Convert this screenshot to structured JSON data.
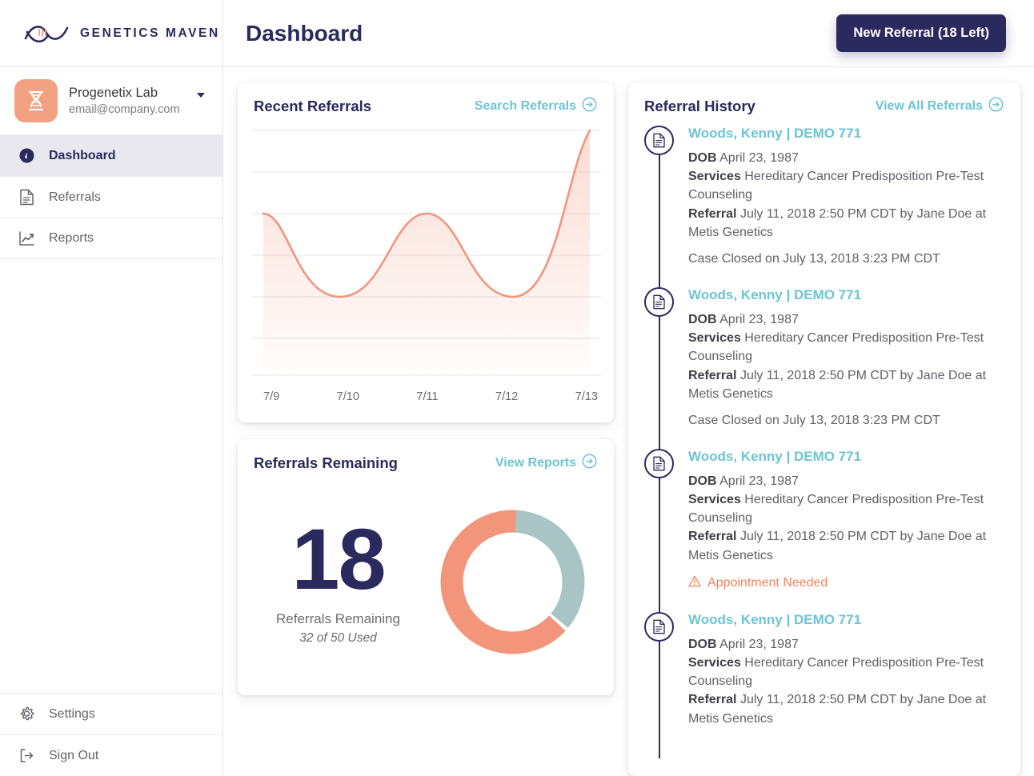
{
  "brand": {
    "name": "GENETICS MAVEN",
    "logo_icon": "dna-wave-icon"
  },
  "account": {
    "avatar_icon": "dna-helix-icon",
    "name": "Progenetix Lab",
    "email": "email@company.com",
    "caret_icon": "chevron-down-icon"
  },
  "sidebar": {
    "items": [
      {
        "label": "Dashboard",
        "icon": "gauge-icon",
        "active": true
      },
      {
        "label": "Referrals",
        "icon": "document-icon",
        "active": false
      },
      {
        "label": "Reports",
        "icon": "chart-line-icon",
        "active": false
      }
    ],
    "bottom_items": [
      {
        "label": "Settings",
        "icon": "gear-icon"
      },
      {
        "label": "Sign Out",
        "icon": "sign-out-icon"
      }
    ]
  },
  "header": {
    "title": "Dashboard",
    "new_referral_label": "New Referral (18 Left)"
  },
  "recent_referrals": {
    "title": "Recent Referrals",
    "link_label": "Search Referrals",
    "link_icon": "arrow-right-circle-icon"
  },
  "referrals_remaining": {
    "title": "Referrals Remaining",
    "link_label": "View Reports",
    "link_icon": "arrow-right-circle-icon",
    "number": "18",
    "label": "Referrals Remaining",
    "sub": "32 of 50 Used"
  },
  "referral_history": {
    "title": "Referral History",
    "link_label": "View All Referrals",
    "link_icon": "arrow-right-circle-icon",
    "items": [
      {
        "node_icon": "document-icon",
        "name": "Woods, Kenny | DEMO 771",
        "dob_label": "DOB",
        "dob_value": "April 23, 1987",
        "services_label": "Services",
        "services_value": "Hereditary Cancer Predisposition Pre-Test Counseling",
        "referral_label": "Referral",
        "referral_value": "July 11, 2018 2:50 PM CDT by Jane Doe at Metis Genetics",
        "status": "Case Closed on July 13, 2018 3:23 PM CDT",
        "alert": ""
      },
      {
        "node_icon": "document-icon",
        "name": "Woods, Kenny | DEMO 771",
        "dob_label": "DOB",
        "dob_value": "April 23, 1987",
        "services_label": "Services",
        "services_value": "Hereditary Cancer Predisposition Pre-Test Counseling",
        "referral_label": "Referral",
        "referral_value": "July 11, 2018 2:50 PM CDT by Jane Doe at Metis Genetics",
        "status": "Case Closed on July 13, 2018 3:23 PM CDT",
        "alert": ""
      },
      {
        "node_icon": "document-icon",
        "name": "Woods, Kenny | DEMO 771",
        "dob_label": "DOB",
        "dob_value": "April 23, 1987",
        "services_label": "Services",
        "services_value": "Hereditary Cancer Predisposition Pre-Test Counseling",
        "referral_label": "Referral",
        "referral_value": "July 11, 2018 2:50 PM CDT by Jane Doe at Metis Genetics",
        "status": "",
        "alert": "Appointment Needed",
        "alert_icon": "warning-triangle-icon"
      },
      {
        "node_icon": "document-icon",
        "name": "Woods, Kenny | DEMO 771",
        "dob_label": "DOB",
        "dob_value": "April 23, 1987",
        "services_label": "Services",
        "services_value": "Hereditary Cancer Predisposition Pre-Test Counseling",
        "referral_label": "Referral",
        "referral_value": "July 11, 2018 2:50 PM CDT by Jane Doe at Metis Genetics",
        "status": "",
        "alert": ""
      }
    ]
  },
  "colors": {
    "navy": "#2a2a5e",
    "teal": "#6cc5d1",
    "orange": "#f3957b",
    "donut_teal": "#a8c4c4",
    "alert_orange": "#f2825c",
    "gridline": "#e4e4e8"
  },
  "chart_data": [
    {
      "type": "area",
      "title": "Recent Referrals",
      "categories": [
        "7/9",
        "7/10",
        "7/11",
        "7/12",
        "7/13"
      ],
      "values": [
        4,
        2,
        4,
        2,
        6
      ],
      "xlabel": "",
      "ylabel": "",
      "ylim": [
        0,
        6
      ],
      "grid": true,
      "gridlines": 7,
      "legend": "none",
      "line_color": "#f3957b",
      "fill": "gradient-orange-to-transparent"
    },
    {
      "type": "pie",
      "title": "Referrals Remaining",
      "labels": [
        "Used",
        "Remaining"
      ],
      "values": [
        32,
        18
      ],
      "total": 50,
      "colors": [
        "#f3957b",
        "#a8c4c4"
      ],
      "donut": true,
      "center_value": "18",
      "center_label": "Referrals Remaining",
      "legend": "none"
    }
  ]
}
